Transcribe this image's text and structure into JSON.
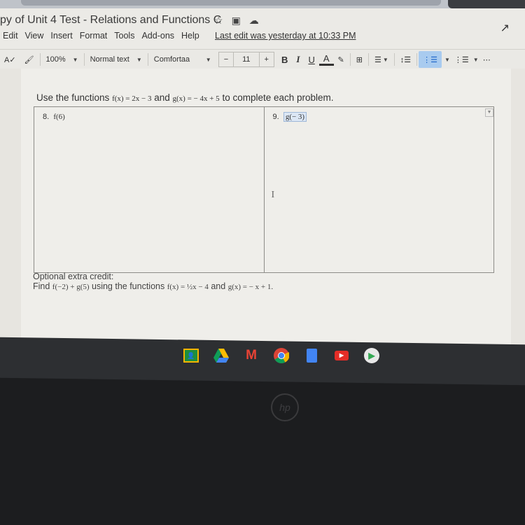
{
  "document": {
    "title": "py of Unit 4 Test - Relations and Functions C",
    "last_edit": "Last edit was yesterday at 10:33 PM"
  },
  "title_icons": [
    "star-icon",
    "move-to-folder-icon",
    "cloud-status-icon"
  ],
  "menu": [
    "Edit",
    "View",
    "Insert",
    "Format",
    "Tools",
    "Add-ons",
    "Help"
  ],
  "toolbar": {
    "zoom": "100%",
    "style": "Normal text",
    "font": "Comfortaa",
    "font_size": "11",
    "decrease": "−",
    "increase": "+",
    "bold": "B",
    "italic": "I",
    "underline": "U",
    "text_color": "A"
  },
  "content": {
    "instruction_pre": "Use the functions ",
    "f_def": "f(x) = 2x − 3",
    "and": " and ",
    "g_def": "g(x) =  − 4x + 5",
    "instruction_post": " to complete each problem.",
    "problems": [
      {
        "number": "8.",
        "expr": "f(6)"
      },
      {
        "number": "9.",
        "expr": "g(− 3)"
      }
    ],
    "extra_title": "Optional extra credit:",
    "extra_find": "Find ",
    "extra_expr": "f(−2) + g(5)",
    "extra_mid": " using the functions ",
    "extra_f": "f(x) = ½x − 4",
    "extra_and": " and ",
    "extra_g": "g(x) =  − x + 1."
  },
  "shelf": {
    "apps": [
      "Classroom",
      "Drive",
      "Gmail",
      "Chrome",
      "Docs",
      "YouTube",
      "Play Store"
    ]
  },
  "colors": {
    "active_button": "#a9cbef",
    "shelf": "#2d2f32"
  }
}
